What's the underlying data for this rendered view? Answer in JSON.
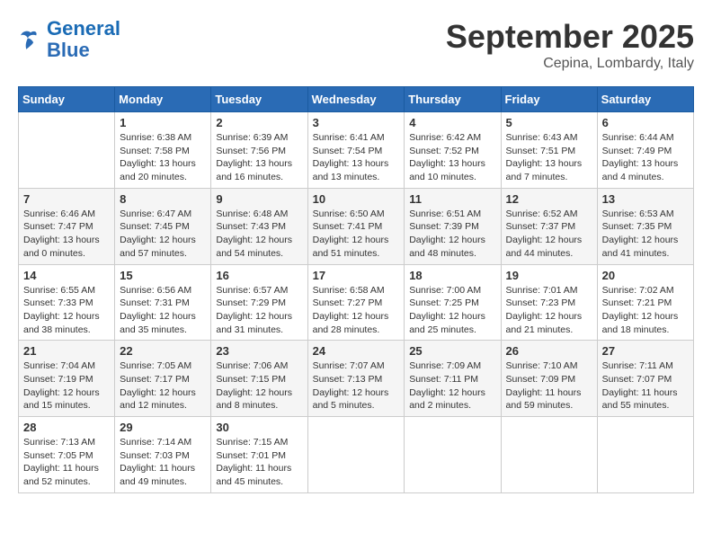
{
  "header": {
    "logo": {
      "line1": "General",
      "line2": "Blue"
    },
    "title": "September 2025",
    "location": "Cepina, Lombardy, Italy"
  },
  "days_of_week": [
    "Sunday",
    "Monday",
    "Tuesday",
    "Wednesday",
    "Thursday",
    "Friday",
    "Saturday"
  ],
  "weeks": [
    [
      {
        "day": "",
        "info": ""
      },
      {
        "day": "1",
        "info": "Sunrise: 6:38 AM\nSunset: 7:58 PM\nDaylight: 13 hours\nand 20 minutes."
      },
      {
        "day": "2",
        "info": "Sunrise: 6:39 AM\nSunset: 7:56 PM\nDaylight: 13 hours\nand 16 minutes."
      },
      {
        "day": "3",
        "info": "Sunrise: 6:41 AM\nSunset: 7:54 PM\nDaylight: 13 hours\nand 13 minutes."
      },
      {
        "day": "4",
        "info": "Sunrise: 6:42 AM\nSunset: 7:52 PM\nDaylight: 13 hours\nand 10 minutes."
      },
      {
        "day": "5",
        "info": "Sunrise: 6:43 AM\nSunset: 7:51 PM\nDaylight: 13 hours\nand 7 minutes."
      },
      {
        "day": "6",
        "info": "Sunrise: 6:44 AM\nSunset: 7:49 PM\nDaylight: 13 hours\nand 4 minutes."
      }
    ],
    [
      {
        "day": "7",
        "info": "Sunrise: 6:46 AM\nSunset: 7:47 PM\nDaylight: 13 hours\nand 0 minutes."
      },
      {
        "day": "8",
        "info": "Sunrise: 6:47 AM\nSunset: 7:45 PM\nDaylight: 12 hours\nand 57 minutes."
      },
      {
        "day": "9",
        "info": "Sunrise: 6:48 AM\nSunset: 7:43 PM\nDaylight: 12 hours\nand 54 minutes."
      },
      {
        "day": "10",
        "info": "Sunrise: 6:50 AM\nSunset: 7:41 PM\nDaylight: 12 hours\nand 51 minutes."
      },
      {
        "day": "11",
        "info": "Sunrise: 6:51 AM\nSunset: 7:39 PM\nDaylight: 12 hours\nand 48 minutes."
      },
      {
        "day": "12",
        "info": "Sunrise: 6:52 AM\nSunset: 7:37 PM\nDaylight: 12 hours\nand 44 minutes."
      },
      {
        "day": "13",
        "info": "Sunrise: 6:53 AM\nSunset: 7:35 PM\nDaylight: 12 hours\nand 41 minutes."
      }
    ],
    [
      {
        "day": "14",
        "info": "Sunrise: 6:55 AM\nSunset: 7:33 PM\nDaylight: 12 hours\nand 38 minutes."
      },
      {
        "day": "15",
        "info": "Sunrise: 6:56 AM\nSunset: 7:31 PM\nDaylight: 12 hours\nand 35 minutes."
      },
      {
        "day": "16",
        "info": "Sunrise: 6:57 AM\nSunset: 7:29 PM\nDaylight: 12 hours\nand 31 minutes."
      },
      {
        "day": "17",
        "info": "Sunrise: 6:58 AM\nSunset: 7:27 PM\nDaylight: 12 hours\nand 28 minutes."
      },
      {
        "day": "18",
        "info": "Sunrise: 7:00 AM\nSunset: 7:25 PM\nDaylight: 12 hours\nand 25 minutes."
      },
      {
        "day": "19",
        "info": "Sunrise: 7:01 AM\nSunset: 7:23 PM\nDaylight: 12 hours\nand 21 minutes."
      },
      {
        "day": "20",
        "info": "Sunrise: 7:02 AM\nSunset: 7:21 PM\nDaylight: 12 hours\nand 18 minutes."
      }
    ],
    [
      {
        "day": "21",
        "info": "Sunrise: 7:04 AM\nSunset: 7:19 PM\nDaylight: 12 hours\nand 15 minutes."
      },
      {
        "day": "22",
        "info": "Sunrise: 7:05 AM\nSunset: 7:17 PM\nDaylight: 12 hours\nand 12 minutes."
      },
      {
        "day": "23",
        "info": "Sunrise: 7:06 AM\nSunset: 7:15 PM\nDaylight: 12 hours\nand 8 minutes."
      },
      {
        "day": "24",
        "info": "Sunrise: 7:07 AM\nSunset: 7:13 PM\nDaylight: 12 hours\nand 5 minutes."
      },
      {
        "day": "25",
        "info": "Sunrise: 7:09 AM\nSunset: 7:11 PM\nDaylight: 12 hours\nand 2 minutes."
      },
      {
        "day": "26",
        "info": "Sunrise: 7:10 AM\nSunset: 7:09 PM\nDaylight: 11 hours\nand 59 minutes."
      },
      {
        "day": "27",
        "info": "Sunrise: 7:11 AM\nSunset: 7:07 PM\nDaylight: 11 hours\nand 55 minutes."
      }
    ],
    [
      {
        "day": "28",
        "info": "Sunrise: 7:13 AM\nSunset: 7:05 PM\nDaylight: 11 hours\nand 52 minutes."
      },
      {
        "day": "29",
        "info": "Sunrise: 7:14 AM\nSunset: 7:03 PM\nDaylight: 11 hours\nand 49 minutes."
      },
      {
        "day": "30",
        "info": "Sunrise: 7:15 AM\nSunset: 7:01 PM\nDaylight: 11 hours\nand 45 minutes."
      },
      {
        "day": "",
        "info": ""
      },
      {
        "day": "",
        "info": ""
      },
      {
        "day": "",
        "info": ""
      },
      {
        "day": "",
        "info": ""
      }
    ]
  ]
}
